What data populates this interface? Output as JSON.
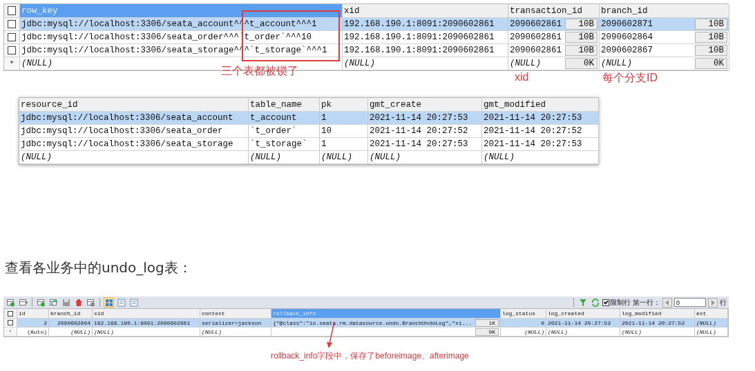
{
  "lock_table": {
    "header_checked": false,
    "columns": [
      {
        "label": "row_key",
        "selected": true
      },
      {
        "label": "xid",
        "selected": false
      },
      {
        "label": "transaction_id",
        "selected": false
      },
      {
        "label": "branch_id",
        "selected": false
      }
    ],
    "rows": [
      {
        "kind": "record",
        "checked": false,
        "selected": true,
        "cells": [
          {
            "text": "jdbc:mysql://localhost:3306/seata_account^^^t_account^^^1"
          },
          {
            "text": "192.168.190.1:8091:2090602861"
          },
          {
            "text": "2090602861",
            "blob": "10B"
          },
          {
            "text": "2090602871",
            "blob": "10B"
          }
        ]
      },
      {
        "kind": "record",
        "checked": false,
        "selected": false,
        "cells": [
          {
            "text": "jdbc:mysql://localhost:3306/seata_order^^^`t_order`^^^10"
          },
          {
            "text": "192.168.190.1:8091:2090602861"
          },
          {
            "text": "2090602861",
            "blob": "10B"
          },
          {
            "text": "2090602864",
            "blob": "10B"
          }
        ]
      },
      {
        "kind": "record",
        "checked": false,
        "selected": false,
        "cells": [
          {
            "text": "jdbc:mysql://localhost:3306/seata_storage^^^`t_storage`^^^1"
          },
          {
            "text": "192.168.190.1:8091:2090602861"
          },
          {
            "text": "2090602861",
            "blob": "10B"
          },
          {
            "text": "2090602867",
            "blob": "10B"
          }
        ]
      },
      {
        "kind": "new",
        "marker": "*",
        "selected": false,
        "cells": [
          {
            "text": "(NULL)",
            "null": true
          },
          {
            "text": "(NULL)",
            "null": true
          },
          {
            "text": "(NULL)",
            "null": true,
            "blob": "0K"
          },
          {
            "text": "(NULL)",
            "null": true,
            "blob": "0K"
          }
        ]
      }
    ],
    "notes": [
      "三个表都被锁了",
      "xid",
      "每个分支ID"
    ]
  },
  "lock_detail_table": {
    "columns": [
      {
        "label": "resource_id",
        "selected": false
      },
      {
        "label": "table_name",
        "selected": false
      },
      {
        "label": "pk",
        "selected": false
      },
      {
        "label": "gmt_create",
        "selected": false
      },
      {
        "label": "gmt_modified",
        "selected": false
      }
    ],
    "rows": [
      {
        "selected": true,
        "cells": [
          {
            "text": "jdbc:mysql://localhost:3306/seata_account"
          },
          {
            "text": "t_account"
          },
          {
            "text": "1"
          },
          {
            "text": "2021-11-14 20:27:53"
          },
          {
            "text": "2021-11-14 20:27:53"
          }
        ]
      },
      {
        "selected": false,
        "cells": [
          {
            "text": "jdbc:mysql://localhost:3306/seata_order"
          },
          {
            "text": "`t_order`"
          },
          {
            "text": "10"
          },
          {
            "text": "2021-11-14 20:27:52"
          },
          {
            "text": "2021-11-14 20:27:52"
          }
        ]
      },
      {
        "selected": false,
        "cells": [
          {
            "text": "jdbc:mysql://localhost:3306/seata_storage"
          },
          {
            "text": "`t_storage`"
          },
          {
            "text": "1"
          },
          {
            "text": "2021-11-14 20:27:53"
          },
          {
            "text": "2021-11-14 20:27:53"
          }
        ]
      },
      {
        "selected": false,
        "cells": [
          {
            "text": "(NULL)",
            "null": true
          },
          {
            "text": "(NULL)",
            "null": true
          },
          {
            "text": "(NULL)",
            "null": true
          },
          {
            "text": "(NULL)",
            "null": true
          },
          {
            "text": "(NULL)",
            "null": true
          }
        ]
      }
    ]
  },
  "paragraph": "查看各业务中的undo_log表：",
  "undo_log": {
    "toolbar": {
      "views": [
        {
          "selected": true
        },
        {
          "selected": false
        },
        {
          "selected": false
        }
      ],
      "limit_rows": {
        "label": "限制行",
        "checked": true
      },
      "first_row_label": "第一行：",
      "first_row_value": "0",
      "rows_label": "行"
    },
    "header_checked": false,
    "columns": [
      {
        "label": "id",
        "selected": false
      },
      {
        "label": "branch_id",
        "selected": false
      },
      {
        "label": "xid",
        "selected": false
      },
      {
        "label": "context",
        "selected": false
      },
      {
        "label": "rollback_info",
        "selected": true
      },
      {
        "label": "log_status",
        "selected": false
      },
      {
        "label": "log_created",
        "selected": false
      },
      {
        "label": "log_modified",
        "selected": false
      },
      {
        "label": "ext",
        "selected": false
      }
    ],
    "rows": [
      {
        "kind": "record",
        "checked": false,
        "selected": true,
        "cells": [
          {
            "text": "2"
          },
          {
            "text": "2090602864"
          },
          {
            "text": "192.168.190.1:8091:2090602861"
          },
          {
            "text": "serializer=jackson"
          },
          {
            "text": "{\"@class\":\"io.seata.rm.datasource.undo.BranchUndoLog\",\"xi...",
            "blob": "1K"
          },
          {
            "text": "0"
          },
          {
            "text": "2021-11-14 20:27:52"
          },
          {
            "text": "2021-11-14 20:27:52"
          },
          {
            "text": "(NULL)",
            "null": true
          }
        ]
      },
      {
        "kind": "new",
        "marker": "*",
        "selected": false,
        "cells": [
          {
            "text": "(Auto)"
          },
          {
            "text": "(NULL)",
            "null": true
          },
          {
            "text": "(NULL)",
            "null": true
          },
          {
            "text": "(NULL)",
            "null": true
          },
          {
            "blob": "0K"
          },
          {
            "text": "(NULL)",
            "null": true
          },
          {
            "text": "(NULL)",
            "null": true
          },
          {
            "text": "(NULL)",
            "null": true
          },
          {
            "text": "(NULL)",
            "null": true
          }
        ]
      }
    ],
    "note": "rollback_info字段中，保存了beforeimage、afterimage"
  }
}
